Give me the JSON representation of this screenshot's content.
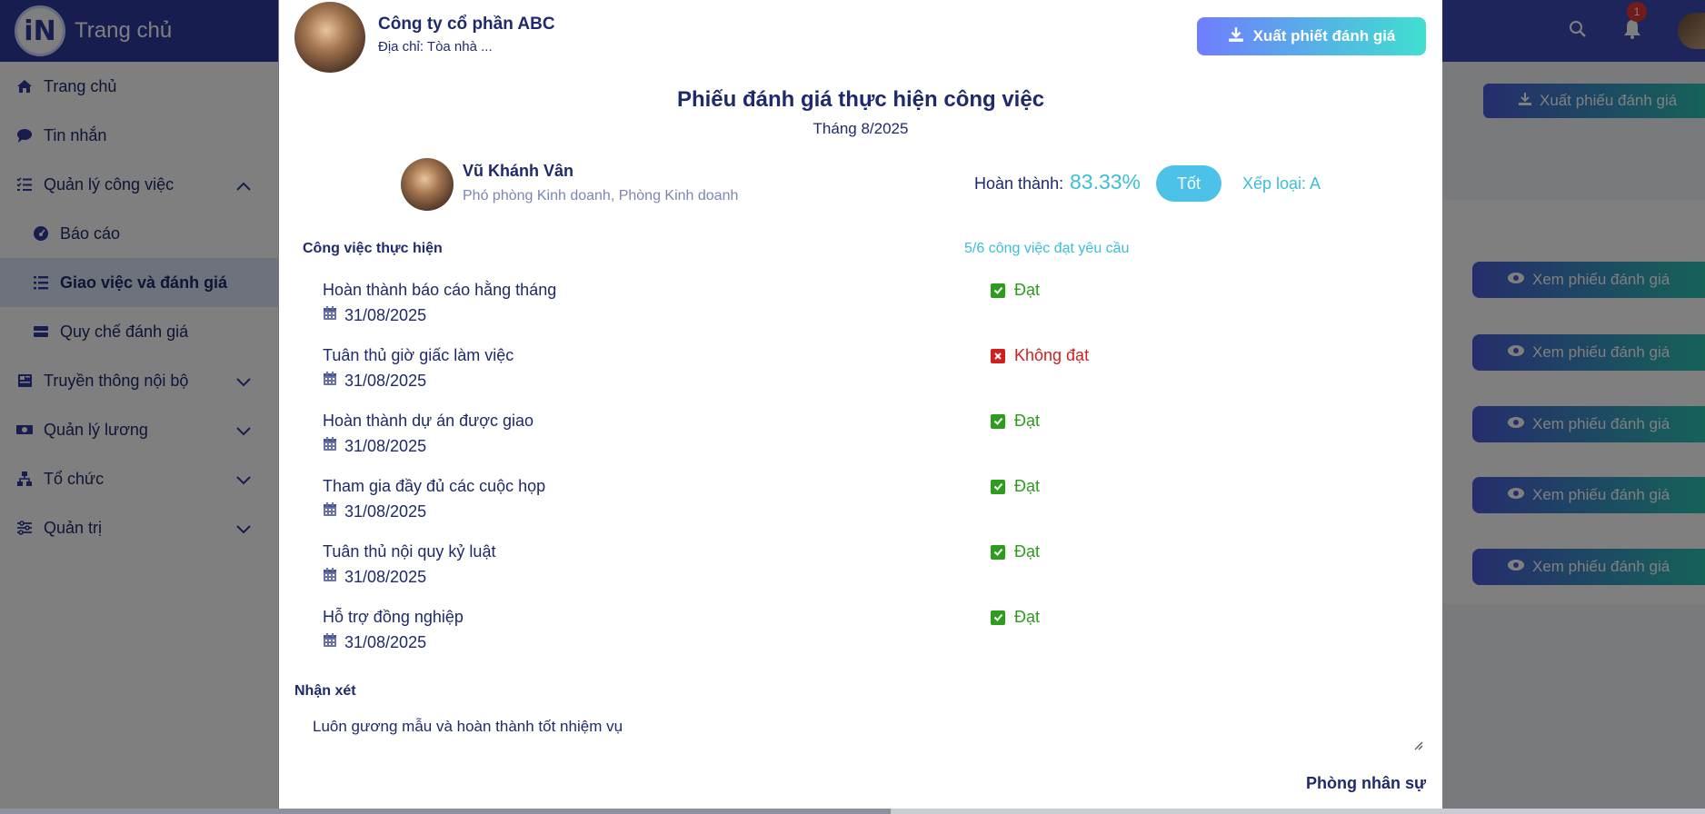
{
  "app": {
    "brand_mark": "iN",
    "brand_title": "Trang chủ",
    "notification_count": "1"
  },
  "sidebar": {
    "items": [
      {
        "label": "Trang chủ",
        "icon": "home-icon"
      },
      {
        "label": "Tin nhắn",
        "icon": "chat-icon"
      },
      {
        "label": "Quản lý công việc",
        "icon": "task-list-icon",
        "expanded": true
      },
      {
        "label": "Báo cáo",
        "icon": "dashboard-icon",
        "sub": true
      },
      {
        "label": "Giao việc và đánh giá",
        "icon": "list-icon",
        "sub": true,
        "active": true
      },
      {
        "label": "Quy chế đánh giá",
        "icon": "server-icon",
        "sub": true
      },
      {
        "label": "Truyền thông nội bộ",
        "icon": "newspaper-icon"
      },
      {
        "label": "Quản lý lương",
        "icon": "money-icon"
      },
      {
        "label": "Tổ chức",
        "icon": "org-chart-icon"
      },
      {
        "label": "Quản trị",
        "icon": "sliders-icon"
      }
    ]
  },
  "background": {
    "export_label": "Xuất phiếu đánh giá",
    "view_label": "Xem phiếu đánh giá"
  },
  "modal": {
    "company_name": "Công ty cổ phần ABC",
    "company_address": "Địa chỉ: Tòa nhà ...",
    "export_button": "Xuất phiết đánh giá",
    "title": "Phiếu đánh giá thực hiện công việc",
    "month": "Tháng 8/2025",
    "employee": {
      "name": "Vũ Khánh Vân",
      "role": "Phó phòng Kinh doanh, Phòng Kinh doanh"
    },
    "completion_label": "Hoàn thành:",
    "completion_value": "83.33%",
    "rating": "Tốt",
    "grade": "Xếp loại: A",
    "section_title": "Công việc thực hiện",
    "summary": "5/6 công việc đạt yêu cầu",
    "tasks": [
      {
        "name": "Hoàn thành báo cáo hằng tháng",
        "date": "31/08/2025",
        "status": "Đạt",
        "passed": true
      },
      {
        "name": "Tuân thủ giờ giấc làm việc",
        "date": "31/08/2025",
        "status": "Không đạt",
        "passed": false
      },
      {
        "name": "Hoàn thành dự án được giao",
        "date": "31/08/2025",
        "status": "Đạt",
        "passed": true
      },
      {
        "name": "Tham gia đầy đủ các cuộc họp",
        "date": "31/08/2025",
        "status": "Đạt",
        "passed": true
      },
      {
        "name": "Tuân thủ nội quy kỷ luật",
        "date": "31/08/2025",
        "status": "Đạt",
        "passed": true
      },
      {
        "name": "Hỗ trợ đồng nghiệp",
        "date": "31/08/2025",
        "status": "Đạt",
        "passed": true
      }
    ],
    "comment_label": "Nhận xét",
    "comment_value": "Luôn gương mẫu và hoàn thành tốt nhiệm vụ",
    "department": "Phòng nhân sự"
  },
  "colors": {
    "primary": "#2e3a9c",
    "accent": "#3bbed6",
    "pass": "#2e9c1c",
    "fail": "#d11f1f"
  }
}
